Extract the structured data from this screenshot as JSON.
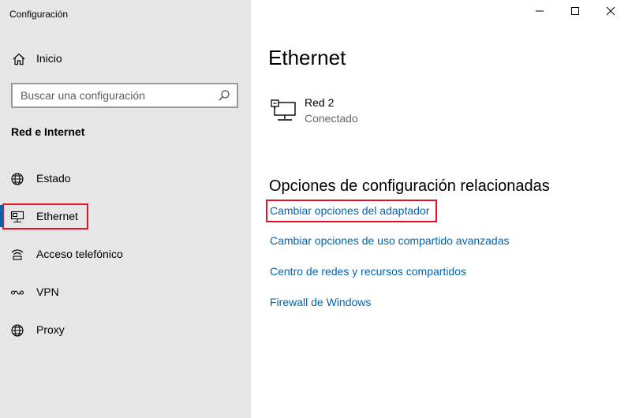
{
  "window": {
    "title": "Configuración"
  },
  "sidebar": {
    "home_label": "Inicio",
    "search_placeholder": "Buscar una configuración",
    "section_title": "Red e Internet",
    "items": [
      {
        "label": "Estado",
        "icon": "globe-icon"
      },
      {
        "label": "Ethernet",
        "icon": "ethernet-icon",
        "selected": true
      },
      {
        "label": "Acceso telefónico",
        "icon": "dial-up-icon"
      },
      {
        "label": "VPN",
        "icon": "vpn-icon"
      },
      {
        "label": "Proxy",
        "icon": "globe-icon"
      }
    ]
  },
  "main": {
    "title": "Ethernet",
    "network": {
      "name": "Red 2",
      "status": "Conectado"
    },
    "related_title": "Opciones de configuración relacionadas",
    "links": [
      "Cambiar opciones del adaptador",
      "Cambiar opciones de uso compartido avanzadas",
      "Centro de redes y recursos compartidos",
      "Firewall de Windows"
    ]
  },
  "colors": {
    "accent": "#0063b1",
    "sidebar_bg": "#e6e6e6",
    "highlight": "#e81123"
  }
}
